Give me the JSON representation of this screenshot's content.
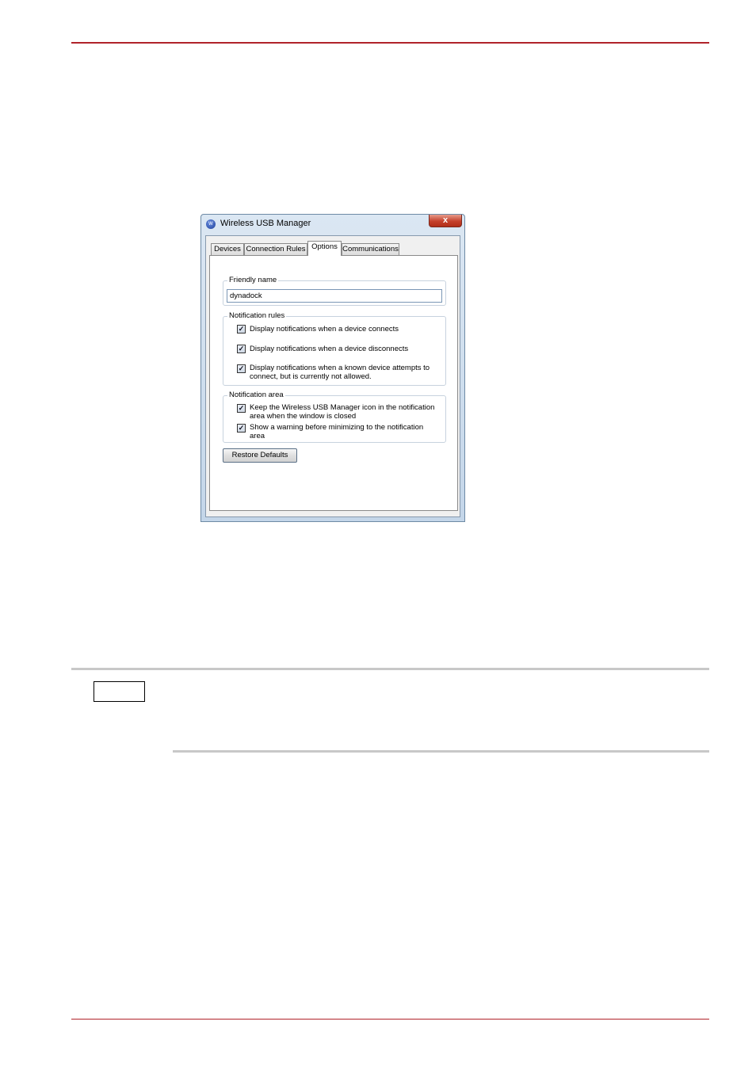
{
  "window": {
    "title": "Wireless USB Manager",
    "close_glyph": "x",
    "icon_name": "wireless-usb-icon",
    "icon_text": "W"
  },
  "tabs": [
    {
      "label": "Devices",
      "active": false
    },
    {
      "label": "Connection Rules",
      "active": false
    },
    {
      "label": "Options",
      "active": true
    },
    {
      "label": "Communications",
      "active": false
    }
  ],
  "friendly_name": {
    "label": "Friendly name",
    "value": "dynadock"
  },
  "notification_rules": {
    "label": "Notification rules",
    "items": [
      {
        "label": "Display notifications when a device connects",
        "checked": true
      },
      {
        "label": "Display notifications when a device disconnects",
        "checked": true
      },
      {
        "label": "Display notifications when a known device attempts to connect, but is currently not allowed.",
        "checked": true
      }
    ]
  },
  "notification_area": {
    "label": "Notification area",
    "items": [
      {
        "label": "Keep the Wireless USB Manager icon in the notification area when the window is closed",
        "checked": true
      },
      {
        "label": "Show a warning before minimizing to the notification area",
        "checked": true
      }
    ]
  },
  "restore_defaults_label": "Restore Defaults",
  "checkmark_glyph": "✓",
  "colors": {
    "header_rule": "#b0232a",
    "note_rule": "#c8c8c8",
    "close_button": "#c5412c"
  }
}
